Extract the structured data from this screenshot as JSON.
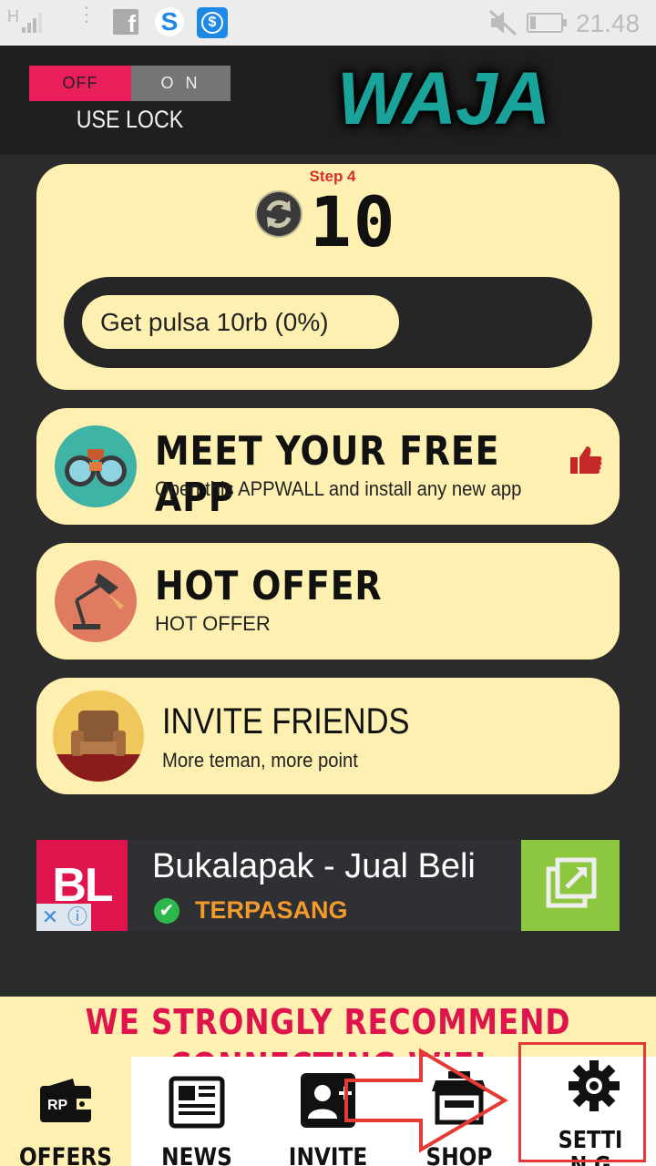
{
  "status_bar": {
    "time": "21.48",
    "network": "H",
    "icons": [
      "signal-icon",
      "menu-dots-icon",
      "facebook-icon",
      "s-app-icon",
      "dollar-app-icon",
      "mute-icon",
      "battery-icon"
    ]
  },
  "header": {
    "lock_toggle": {
      "off_label": "OFF",
      "on_label": "O N",
      "state": "OFF"
    },
    "lock_caption": "USE LOCK",
    "logo_text": "WAJA"
  },
  "step_card": {
    "step_label": "Step 4",
    "count": "10",
    "progress_text": "Get pulsa 10rb (0%)",
    "progress_percent": 0
  },
  "menu": [
    {
      "title": "MEET YOUR FREE APP",
      "subtitle": "Open this APPWALL and install any new app",
      "icon": "binoculars-icon",
      "badge_icon": "thumbs-up-icon"
    },
    {
      "title": "HOT OFFER",
      "subtitle": "HOT OFFER",
      "icon": "desk-lamp-icon"
    },
    {
      "title": "INVITE FRIENDS",
      "subtitle": "More teman, more point",
      "icon": "armchair-icon"
    }
  ],
  "ad": {
    "logo_text": "BL",
    "title": "Bukalapak - Jual Beli",
    "status": "TERPASANG",
    "icons": [
      "close-icon",
      "info-icon",
      "check-icon",
      "open-external-icon"
    ]
  },
  "banner": {
    "text": "WE STRONGLY RECOMMEND CONNECTING WIFI"
  },
  "bottom_nav": [
    {
      "label": "OFFERS",
      "icon": "wallet-icon",
      "active": true
    },
    {
      "label": "NEWS",
      "icon": "newspaper-icon",
      "active": false
    },
    {
      "label": "INVITE",
      "icon": "add-user-icon",
      "active": false
    },
    {
      "label": "SHOP",
      "icon": "shop-icon",
      "active": false
    },
    {
      "label": "SETTIN G",
      "icon": "gear-icon",
      "active": false
    }
  ],
  "colors": {
    "card_bg": "#fdf0b0",
    "accent_pink": "#e91e5a",
    "logo_teal": "#1aa39a",
    "step_red": "#d32f2f",
    "ad_green": "#8dc63f",
    "highlight_red": "#e53935"
  }
}
